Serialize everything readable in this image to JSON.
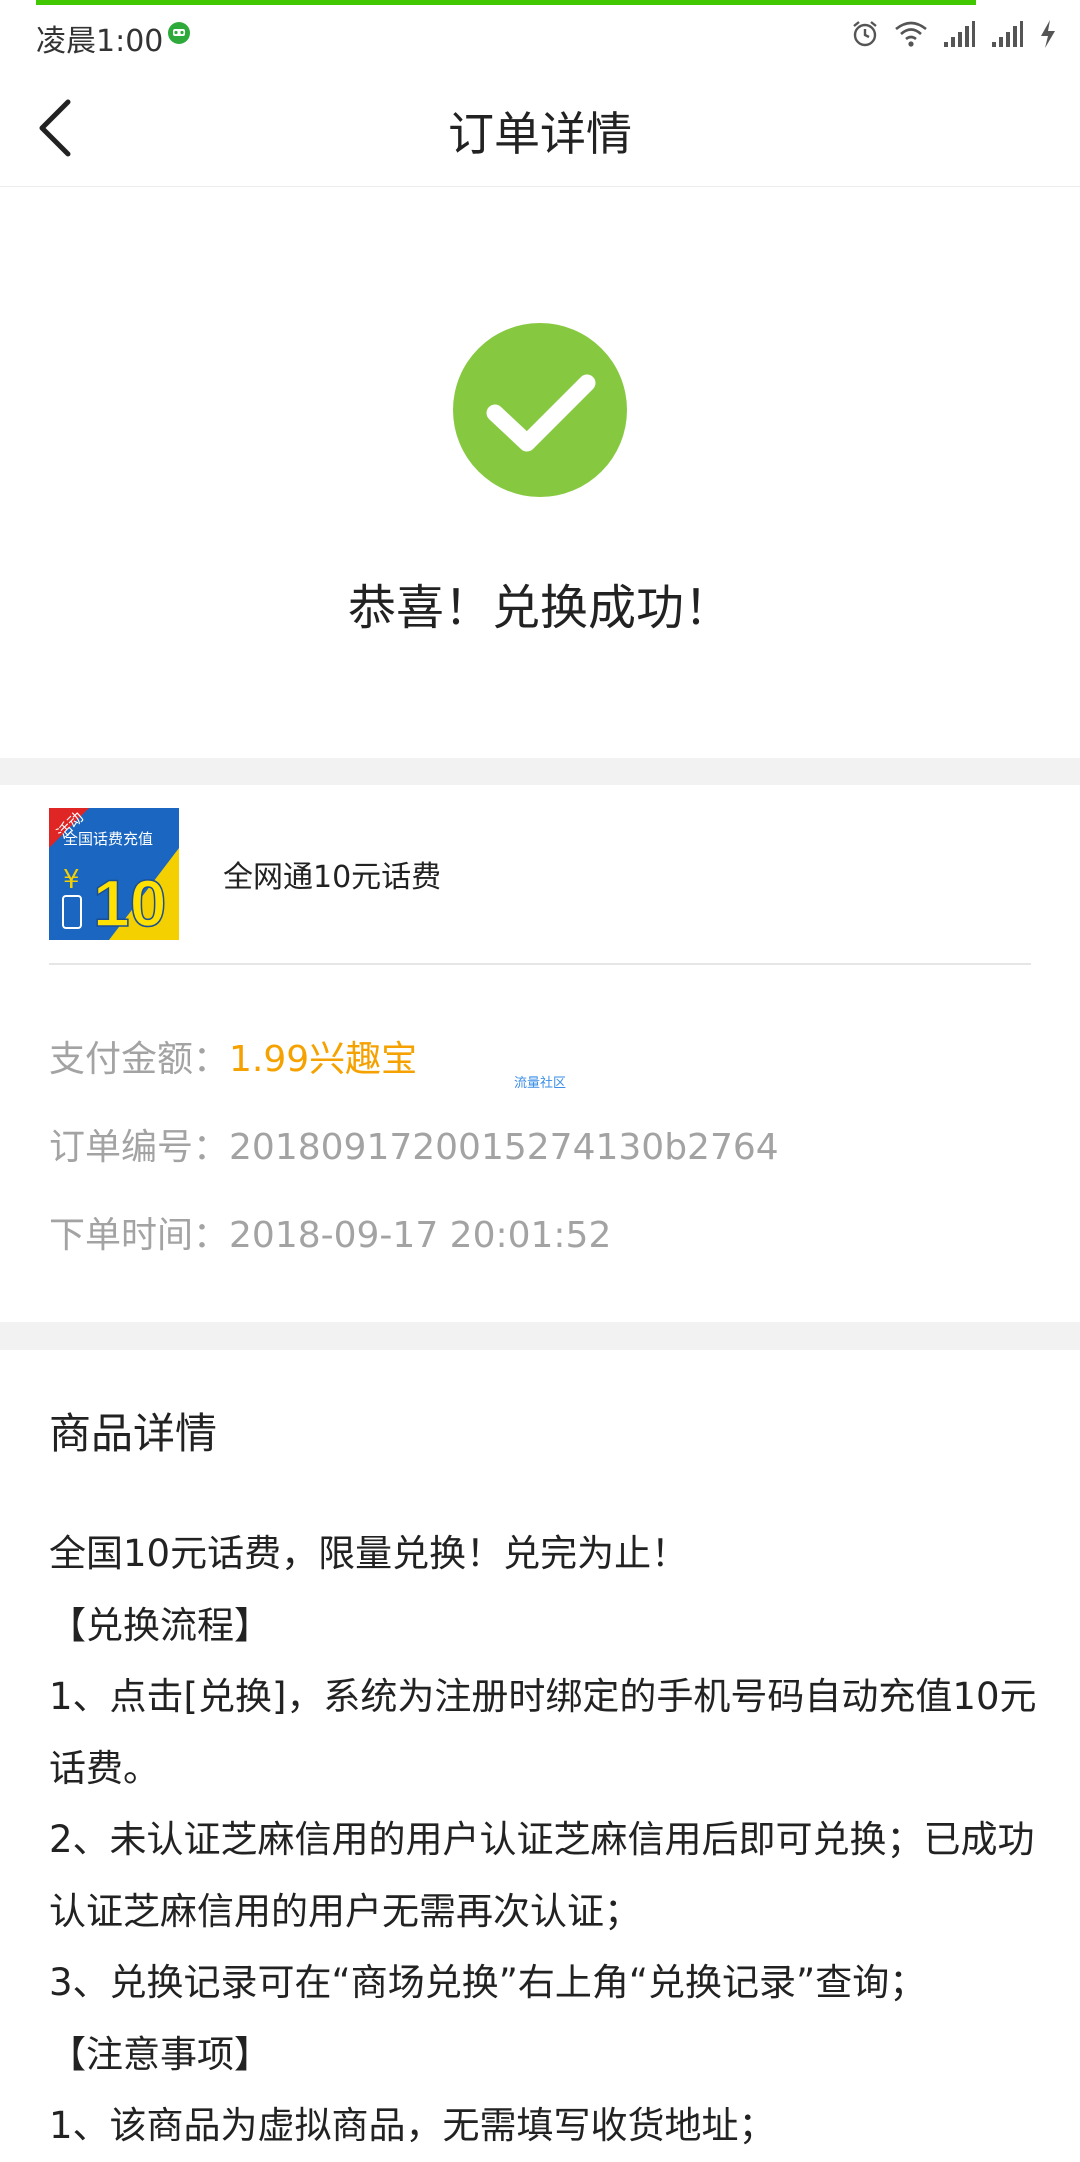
{
  "status_bar": {
    "time": "凌晨1:00",
    "icons": [
      "alarm-icon",
      "wifi-icon",
      "signal-icon",
      "signal-icon",
      "charging-icon"
    ]
  },
  "nav": {
    "title": "订单详情",
    "back_icon": "chevron-left-icon"
  },
  "success": {
    "icon": "check-circle-icon",
    "message": "恭喜！兑换成功！",
    "color": "#86c940"
  },
  "product": {
    "name": "全网通10元话费",
    "image": {
      "badge": "活动",
      "caption": "全国话费充值",
      "currency": "¥",
      "amount": "10"
    }
  },
  "order": {
    "pay_label": "支付金额：",
    "pay_value": "1.99兴趣宝",
    "number_label": "订单编号：",
    "number_value": "2018091720015274130b2764",
    "time_label": "下单时间：",
    "time_value": "2018-09-17 20:01:52",
    "accent_color": "#f5a100"
  },
  "watermark": "流量社区",
  "details": {
    "title": "商品详情",
    "lines": [
      "全国10元话费，限量兑换！兑完为止！",
      "【兑换流程】",
      "1、点击[兑换]，系统为注册时绑定的手机号码自动充值10元话费。",
      "2、未认证芝麻信用的用户认证芝麻信用后即可兑换；已成功认证芝麻信用的用户无需再次认证；",
      "3、兑换记录可在“商场兑换”右上角“兑换记录”查询；",
      "【注意事项】",
      "1、该商品为虚拟商品，无需填写收货地址；"
    ]
  }
}
